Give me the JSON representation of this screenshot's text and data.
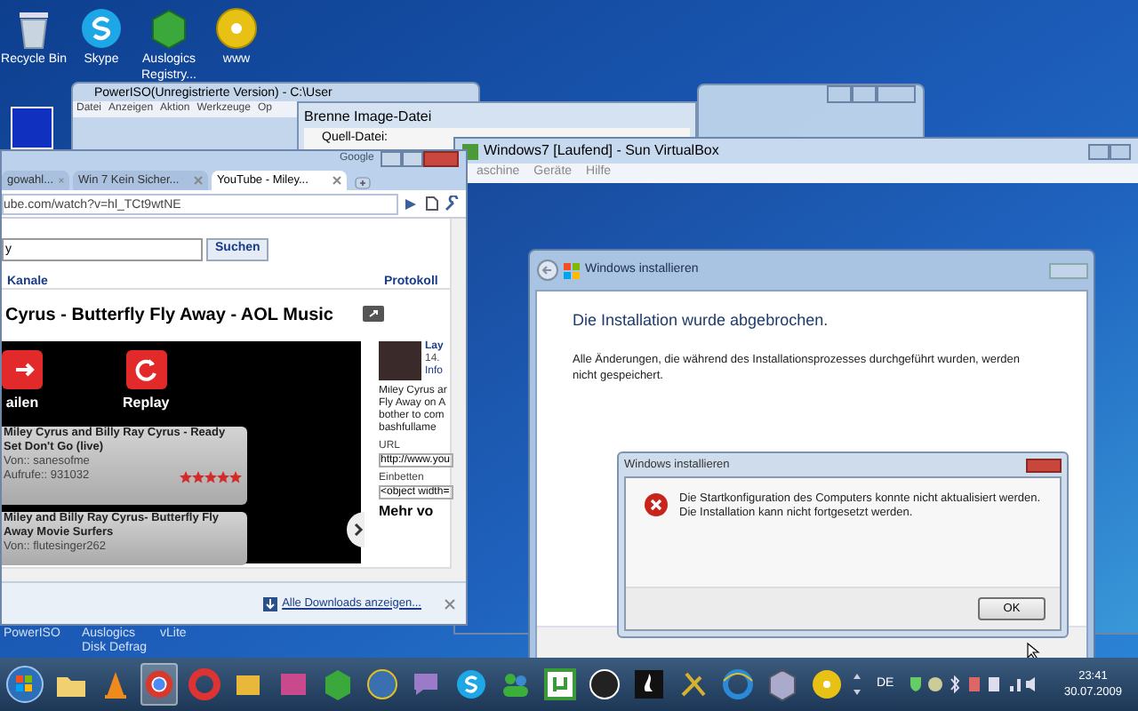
{
  "desktop_icons": [
    {
      "label": "Recycle Bin"
    },
    {
      "label": "Skype"
    },
    {
      "label": "Auslogics Registry..."
    },
    {
      "label": "www"
    }
  ],
  "desktop_icons_lower": [
    {
      "label": "PowerISO"
    },
    {
      "label": "Auslogics Disk Defrag"
    },
    {
      "label": "vLite"
    }
  ],
  "poweriso": {
    "title": "PowerISO(Unregistrierte Version) - C:\\User",
    "menu": [
      "Datei",
      "Anzeigen",
      "Aktion",
      "Werkzeuge",
      "Op"
    ]
  },
  "burn_dialog": {
    "title": "Brenne Image-Datei",
    "field_label": "Quell-Datei:"
  },
  "browser": {
    "corner_text": "Google",
    "tabs": [
      {
        "label": "gowahl...",
        "selected": false
      },
      {
        "label": "Win 7 Kein Sicher...",
        "selected": false
      },
      {
        "label": "YouTube - Miley...",
        "selected": true
      }
    ],
    "url": "ube.com/watch?v=hl_TCt9wtNE",
    "search_value": "y",
    "search_button": "Suchen",
    "nav": [
      "Kanale",
      "Protokoll"
    ],
    "video_title": "Cyrus - Butterfly Fly Away - AOL Music",
    "player_buttons": [
      "ailen",
      "Replay"
    ],
    "related": [
      {
        "title": "Miley Cyrus and Billy Ray Cyrus - Ready Set Don't Go (live)",
        "from": "Von:: sanesofme",
        "views": "Aufrufe:: 931032",
        "stars": 5
      },
      {
        "title": "Miley and Billy Ray Cyrus- Butterfly Fly Away Movie Surfers",
        "from": "Von:: flutesinger262"
      }
    ],
    "side": {
      "name": "Lay",
      "date": "14.",
      "info": "Info",
      "description": "Miley Cyrus ar Fly Away on A bother to com bashfullame",
      "url_label": "URL",
      "url_value": "http://www.you",
      "embed_label": "Einbetten",
      "embed_value": "<object width=",
      "more": "Mehr vo"
    },
    "downloads_link": "Alle Downloads anzeigen..."
  },
  "virtualbox": {
    "title": "Windows7 [Laufend] - Sun VirtualBox",
    "menu": [
      "aschine",
      "Geräte",
      "Hilfe"
    ],
    "installer": {
      "title": "Windows installieren",
      "heading": "Die Installation wurde abgebrochen.",
      "body": "Alle Änderungen, die während des Installationsprozesses durchgeführt wurden, werden nicht gespeichert.",
      "dialog": {
        "title": "Windows installieren",
        "message": "Die Startkonfiguration des Computers konnte nicht aktualisiert werden. Die Installation kann nicht fortgesetzt werden.",
        "button": "OK"
      }
    }
  },
  "taskbar": {
    "language": "DE",
    "time": "23:41",
    "date": "30.07.2009"
  }
}
